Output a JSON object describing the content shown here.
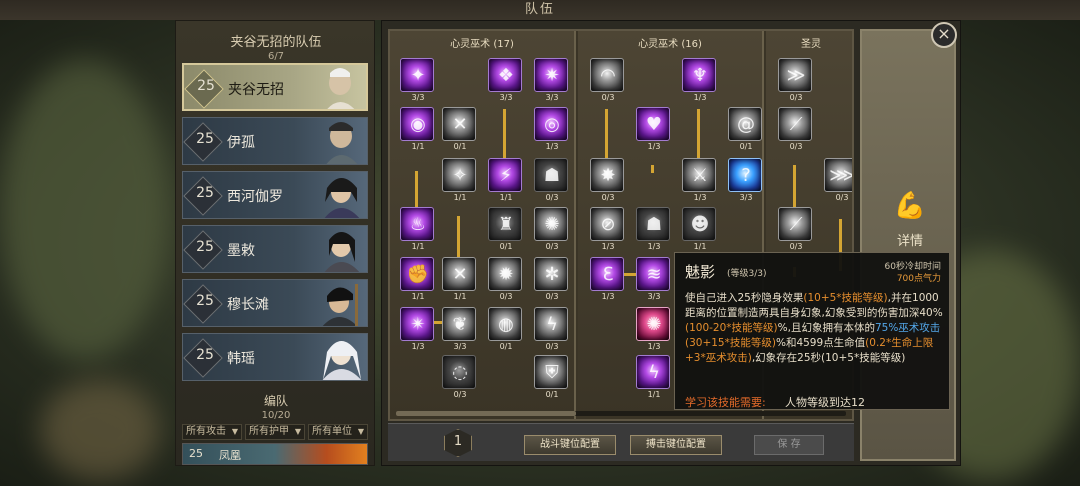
{
  "window": {
    "title": "队伍"
  },
  "team": {
    "title": "夹谷无招的队伍",
    "count": "6/7",
    "heroes": [
      {
        "level": "25",
        "name": "夹谷无招",
        "selected": true
      },
      {
        "level": "25",
        "name": "伊孤"
      },
      {
        "level": "25",
        "name": "西河伽罗"
      },
      {
        "level": "25",
        "name": "墨敕"
      },
      {
        "level": "25",
        "name": "穆长滩"
      },
      {
        "level": "25",
        "name": "韩瑶"
      }
    ]
  },
  "formation": {
    "title": "编队",
    "count": "10/20",
    "filters": [
      "所有攻击",
      "所有护甲",
      "所有单位"
    ],
    "unit": {
      "level": "25",
      "name": "凤凰"
    }
  },
  "skill_tree": {
    "columns": [
      {
        "header": "心灵巫术 (17)"
      },
      {
        "header": "心灵巫术 (16)"
      },
      {
        "header": "圣灵"
      }
    ],
    "skills": [
      {
        "count": "3/3"
      },
      {
        "count": "3/3"
      },
      {
        "count": "3/3"
      },
      {
        "count": "1/1"
      },
      {
        "count": "0/1"
      },
      {
        "count": "1/3"
      },
      {
        "count": "1/1"
      },
      {
        "count": "1/1"
      },
      {
        "count": "0/3"
      },
      {
        "count": "1/1"
      },
      {
        "count": "0/1"
      },
      {
        "count": "0/3"
      },
      {
        "count": "1/1"
      },
      {
        "count": "1/1"
      },
      {
        "count": "0/3"
      },
      {
        "count": "0/3"
      },
      {
        "count": "1/3"
      },
      {
        "count": "3/3"
      },
      {
        "count": "0/1"
      },
      {
        "count": "0/3"
      },
      {
        "count": "0/3"
      },
      {
        "count": "0/1"
      },
      {
        "count": "0/3"
      },
      {
        "count": "1/3"
      },
      {
        "count": "0/1"
      },
      {
        "count": "1/3"
      },
      {
        "count": "0/3"
      },
      {
        "count": "1/3"
      },
      {
        "count": "3/3"
      },
      {
        "count": "1/3"
      },
      {
        "count": "1/3"
      },
      {
        "count": "1/1"
      },
      {
        "count": "0/3"
      },
      {
        "count": "0/3"
      },
      {
        "count": "0/3"
      },
      {
        "count": "0/3"
      }
    ],
    "points": "1"
  },
  "buttons": {
    "battle_keys": "战斗键位配置",
    "strike_keys": "搏击键位配置",
    "save": "保 存",
    "detail": "详情",
    "close": "×"
  },
  "tooltip": {
    "name": "魅影",
    "level": "(等级3/3)",
    "cooldown": "60秒冷却时间",
    "cost": "700点气力",
    "desc_1": "使自己进入25秒隐身效果",
    "desc_2": "(10+5*技能等级)",
    "desc_3": ",并在1000距离的位置制造两具自身幻象,幻象受到的伤害加深40%",
    "desc_4": "(100-20*技能等级)",
    "desc_5": "%,且幻象拥有本体的",
    "desc_6": "75%巫术攻击",
    "desc_7": "(30+15*技能等级)",
    "desc_8": "%和4599点生命值",
    "desc_9": "(0.2*生命上限+3*巫术攻击)",
    "desc_10": ",幻象存在25秒(10+5*技能等级)",
    "req_label": "学习该技能需要:",
    "req_value": "人物等级到达12"
  },
  "colors": {
    "gold": "#d4a533",
    "orange": "#e58e2e",
    "blue": "#53a7e8"
  }
}
